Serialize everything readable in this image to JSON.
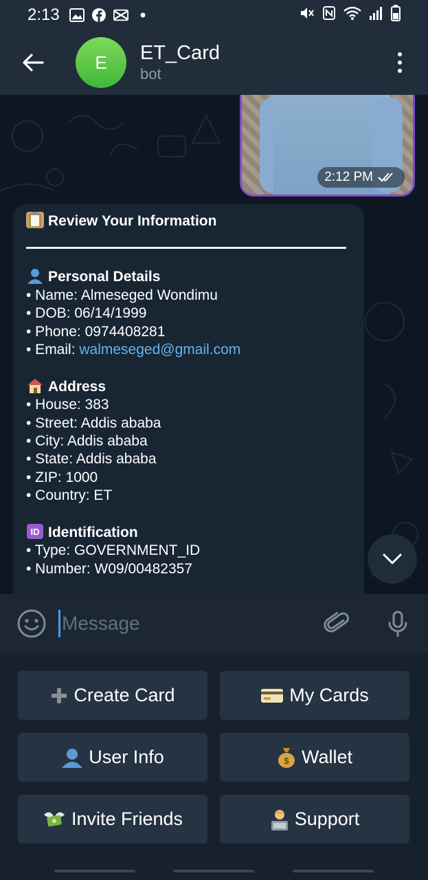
{
  "status_bar": {
    "time": "2:13",
    "left_icons": [
      "gallery-icon",
      "facebook-icon",
      "capcut-icon",
      "dot-icon"
    ],
    "right_icons": [
      "mute-icon",
      "nfc-icon",
      "wifi-icon",
      "signal-icon",
      "battery-icon"
    ]
  },
  "header": {
    "avatar_letter": "E",
    "title": "ET_Card",
    "subtitle": "bot"
  },
  "photo_message": {
    "time": "2:12 PM"
  },
  "review_message": {
    "title": "Review Your Information",
    "personal": {
      "heading": "Personal Details",
      "name": "• Name: Almeseged Wondimu",
      "dob": "• DOB: 06/14/1999",
      "phone": "• Phone: 0974408281",
      "email_prefix": "• Email: ",
      "email": "walmeseged@gmail.com"
    },
    "address": {
      "heading": "Address",
      "house": "• House: 383",
      "street": "• Street: Addis ababa",
      "city": "• City: Addis ababa",
      "state": "• State: Addis ababa",
      "zip": "• ZIP: 1000",
      "country": "• Country: ET"
    },
    "identification": {
      "heading": "Identification",
      "type": "• Type: GOVERNMENT_ID",
      "number": "• Number: W09/00482357"
    }
  },
  "input": {
    "placeholder": "Message"
  },
  "keyboard": {
    "create_card": "Create Card",
    "my_cards": "My Cards",
    "user_info": "User Info",
    "wallet": "Wallet",
    "invite_friends": "Invite Friends",
    "support": "Support"
  },
  "colors": {
    "header_bg": "#212d3b",
    "chat_bg": "#0e1621",
    "bubble_bg": "#182533",
    "link": "#64b5ef",
    "avatar": "#4cbf45",
    "button_bg": "#253342",
    "photo_border": "#7d4bc9"
  }
}
